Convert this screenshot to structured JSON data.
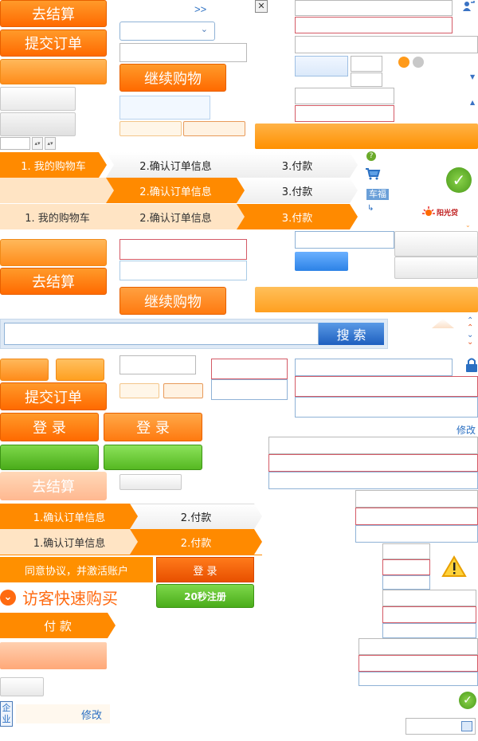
{
  "buttons": {
    "checkout": "去结算",
    "submit_order": "提交订单",
    "continue_shopping": "继续购物",
    "login": "登 录",
    "search": "搜 索",
    "agree_activate": "同意协议，并激活账户",
    "guest_buy": "访客快速购买",
    "register_20s": "20秒注册",
    "pay": "付 款",
    "modify": "修改",
    "enterprise": "企业"
  },
  "arrows": {
    "double_right": ">>"
  },
  "steps3": [
    "1. 我的购物车",
    "2.确认订单信息",
    "3.付款"
  ],
  "steps2": [
    "1.确认订单信息",
    "2.付款"
  ],
  "icons": {
    "close": "close-icon",
    "user": "user-icon",
    "lock": "lock-icon",
    "warning": "warning-icon",
    "check": "check-icon",
    "cart": "cart-icon",
    "help": "help-icon",
    "calendar": "calendar-icon"
  },
  "logo_text": "阳光贷",
  "tag_text": "车福",
  "colors": {
    "orange": "#ff8a00",
    "green": "#4aac1a",
    "blue": "#2a6fc2"
  }
}
